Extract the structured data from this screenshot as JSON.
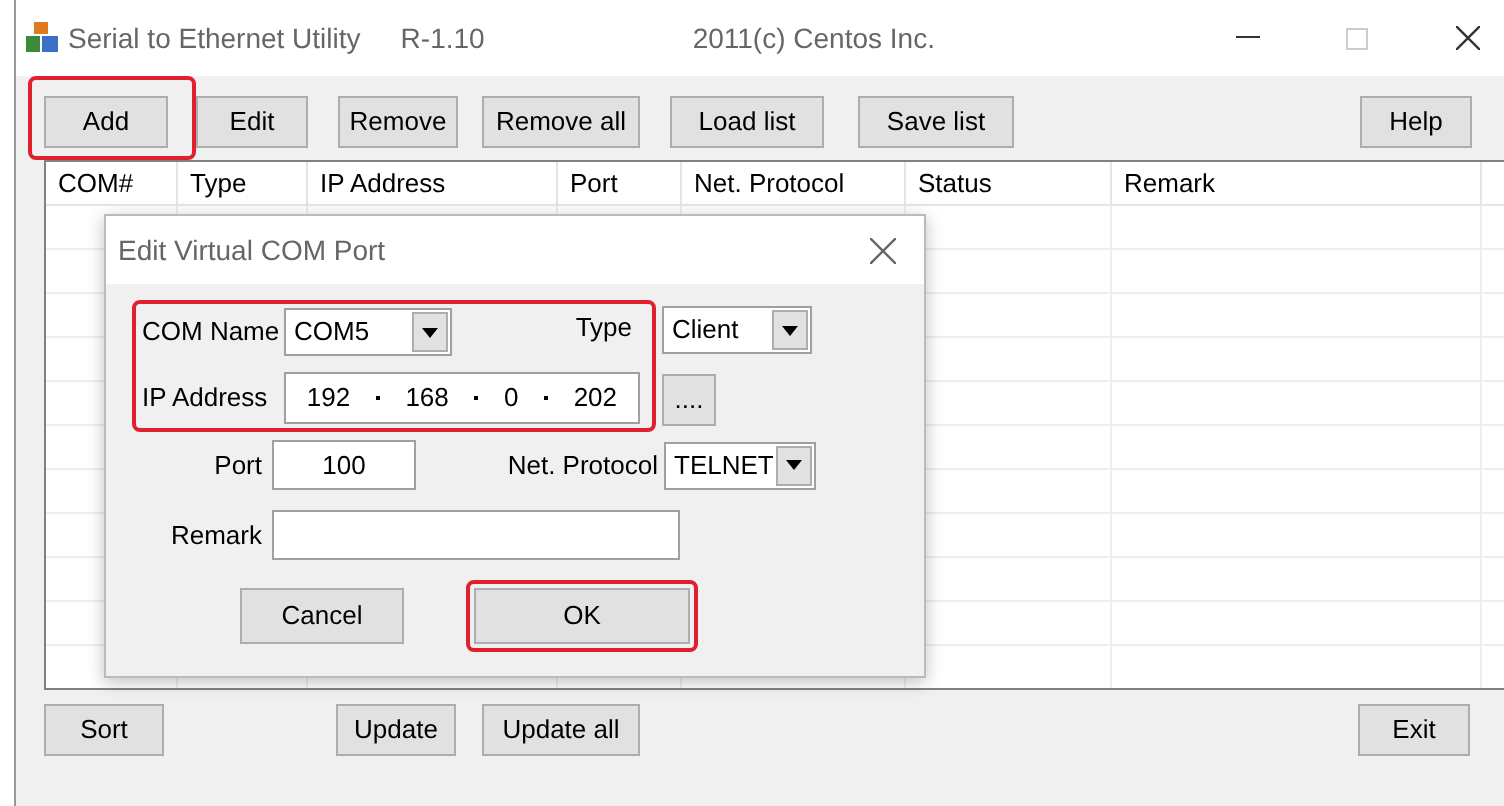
{
  "window": {
    "title": "Serial to Ethernet Utility",
    "version": "R-1.10",
    "copyright": "2011(c)  Centos Inc."
  },
  "toolbar": [
    {
      "label": "Add",
      "highlighted": true
    },
    {
      "label": "Edit",
      "highlighted": false
    },
    {
      "label": "Remove",
      "highlighted": false
    },
    {
      "label": "Remove all",
      "highlighted": false
    },
    {
      "label": "Load list",
      "highlighted": false
    },
    {
      "label": "Save list",
      "highlighted": false
    },
    {
      "label": "Help",
      "highlighted": false
    }
  ],
  "table": {
    "columns": [
      "COM#",
      "Type",
      "IP Address",
      "Port",
      "Net. Protocol",
      "Status",
      "Remark"
    ]
  },
  "dialog": {
    "title": "Edit Virtual COM Port",
    "fields_highlighted": true,
    "com_name": {
      "label": "COM Name",
      "value": "COM5"
    },
    "type": {
      "label": "Type",
      "value": "Client"
    },
    "ip_address": {
      "label": "IP Address",
      "octets": [
        "192",
        "168",
        "0",
        "202"
      ]
    },
    "browse_button": "....",
    "port": {
      "label": "Port",
      "value": "100"
    },
    "net_protocol": {
      "label": "Net. Protocol",
      "value": "TELNET"
    },
    "remark": {
      "label": "Remark"
    },
    "buttons": [
      {
        "label": "Cancel",
        "highlighted": false
      },
      {
        "label": "OK",
        "highlighted": true
      }
    ]
  },
  "bottom_buttons": [
    {
      "label": "Sort"
    },
    {
      "label": "Update"
    },
    {
      "label": "Update all"
    },
    {
      "label": "Exit"
    }
  ]
}
